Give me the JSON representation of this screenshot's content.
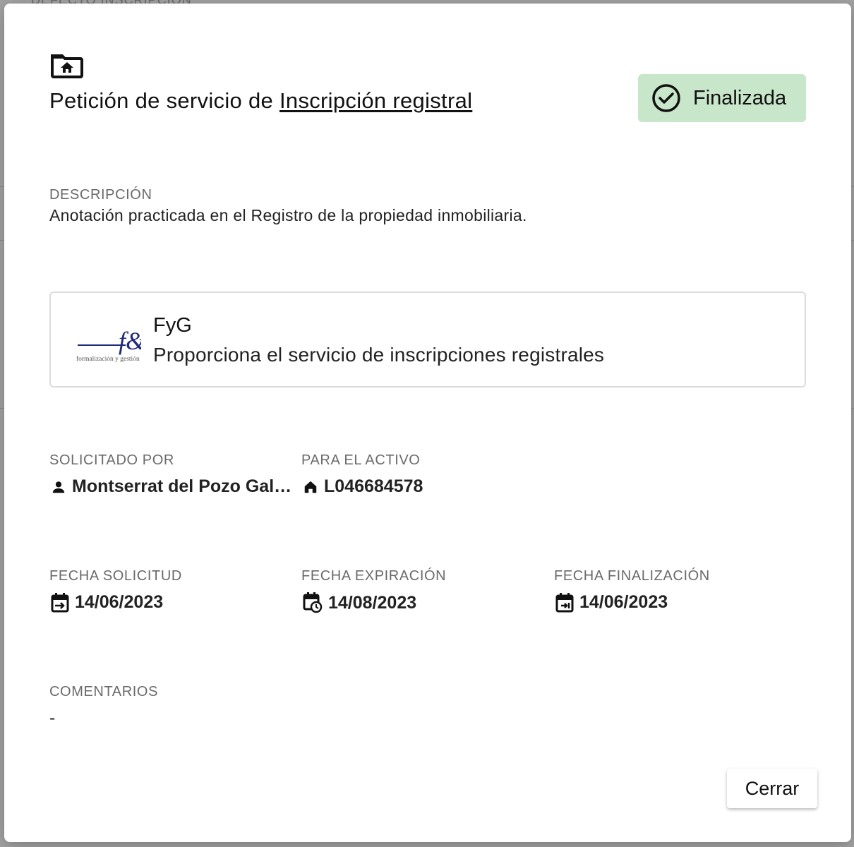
{
  "background": {
    "partial_heading": "DEFECTO INSCRIPCIÓN"
  },
  "header": {
    "icon": "folder-home-icon",
    "title_prefix": "Petición de servicio de ",
    "title_link": "Inscripción registral"
  },
  "status": {
    "label": "Finalizada",
    "icon": "check-circle-icon",
    "color": "#c8e6c9"
  },
  "description": {
    "label": "DESCRIPCIÓN",
    "text": "Anotación practicada en el Registro de la propiedad inmobiliaria."
  },
  "provider": {
    "name": "FyG",
    "description": "Proporciona el servicio de inscripciones registrales",
    "logo_text": "f&g",
    "logo_subtext": "formalización y gestión"
  },
  "requested_by": {
    "label": "SOLICITADO POR",
    "value": "Montserrat del Pozo Gall...",
    "icon": "person-icon"
  },
  "asset": {
    "label": "PARA EL ACTIVO",
    "value": "L046684578",
    "icon": "home-icon"
  },
  "dates": {
    "request": {
      "label": "FECHA SOLICITUD",
      "value": "14/06/2023",
      "icon": "calendar-arrow-icon"
    },
    "expiration": {
      "label": "FECHA EXPIRACIÓN",
      "value": "14/08/2023",
      "icon": "calendar-clock-icon"
    },
    "completion": {
      "label": "FECHA FINALIZACIÓN",
      "value": "14/06/2023",
      "icon": "calendar-end-icon"
    }
  },
  "comments": {
    "label": "COMENTARIOS",
    "value": "-"
  },
  "footer": {
    "close_label": "Cerrar"
  }
}
